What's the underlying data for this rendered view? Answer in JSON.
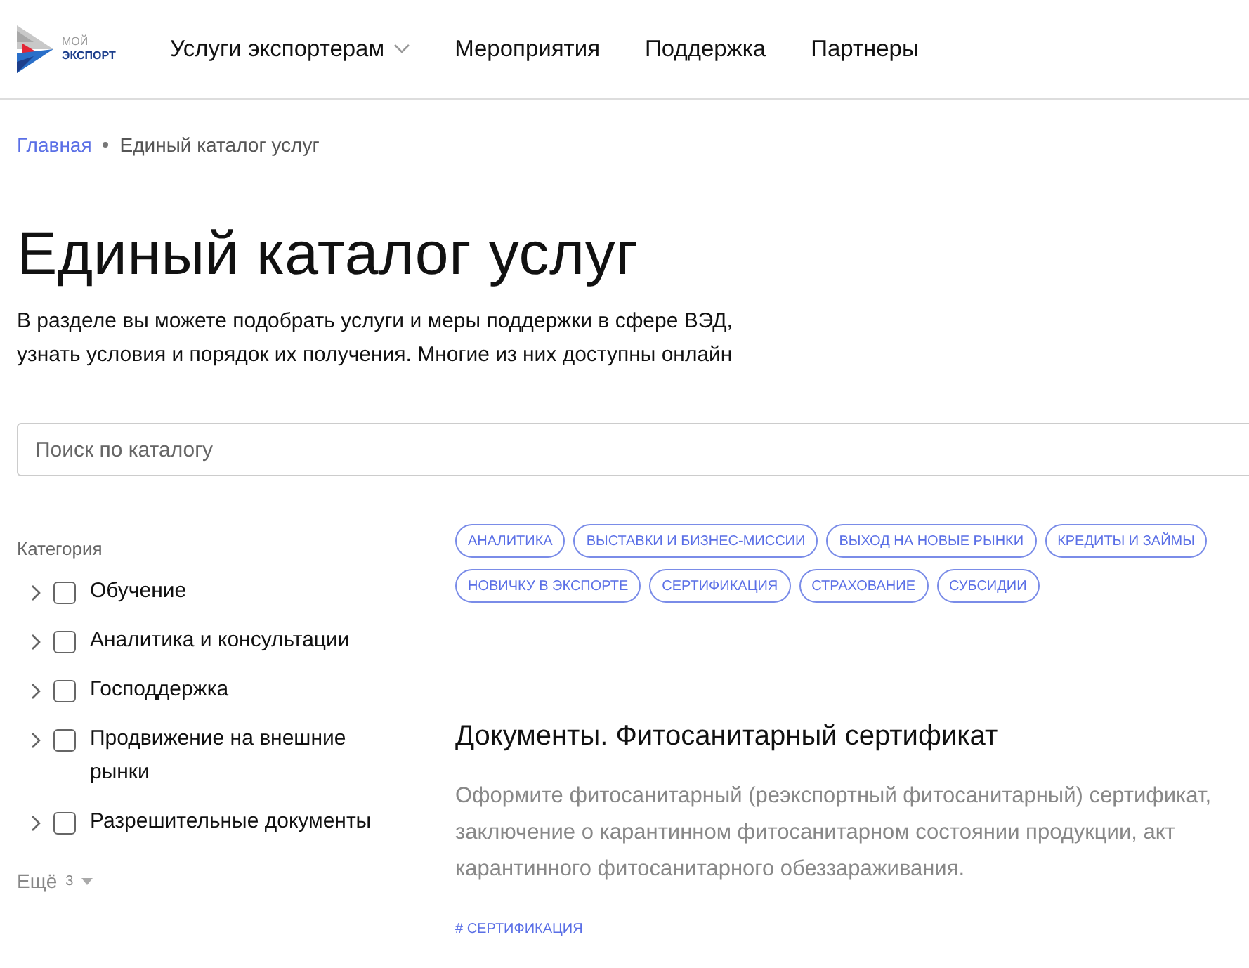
{
  "header": {
    "logo": {
      "top": "МОЙ",
      "bottom": "ЭКСПОРТ"
    },
    "nav": [
      {
        "label": "Услуги экспортерам",
        "dropdown": true
      },
      {
        "label": "Мероприятия",
        "dropdown": false
      },
      {
        "label": "Поддержка",
        "dropdown": false
      },
      {
        "label": "Партнеры",
        "dropdown": false
      }
    ]
  },
  "breadcrumbs": [
    {
      "label": "Главная",
      "link": true
    },
    {
      "label": "Единый каталог услуг",
      "link": false
    }
  ],
  "title": "Единый каталог услуг",
  "description": "В разделе вы можете подобрать услуги и меры поддержки в сфере ВЭД, узнать условия и порядок их получения. Многие из них доступны онлайн",
  "search": {
    "placeholder": "Поиск по каталогу"
  },
  "filter": {
    "title": "Категория",
    "items": [
      {
        "label": "Обучение",
        "checked": false
      },
      {
        "label": "Аналитика и консультации",
        "checked": false
      },
      {
        "label": "Господдержка",
        "checked": false
      },
      {
        "label": "Продвижение на внешние рынки",
        "checked": false
      },
      {
        "label": "Разрешительные документы",
        "checked": false
      }
    ],
    "more": {
      "label": "Ещё",
      "count": "3"
    }
  },
  "tags": [
    "АНАЛИТИКА",
    "ВЫСТАВКИ И БИЗНЕС-МИССИИ",
    "ВЫХОД НА НОВЫЕ РЫНКИ",
    "КРЕДИТЫ И ЗАЙМЫ",
    "НОВИЧКУ В ЭКСПОРТЕ",
    "СЕРТИФИКАЦИЯ",
    "СТРАХОВАНИЕ",
    "СУБСИДИИ"
  ],
  "card": {
    "title": "Документы. Фитосанитарный сертификат",
    "text": "Оформите фитосанитарный (реэкспортный фитосанитарный) сертификат, заключение о карантинном фитосанитарном состоянии продукции, акт карантинного фитосанитарного обеззараживания.",
    "tag": "# СЕРТИФИКАЦИЯ"
  }
}
